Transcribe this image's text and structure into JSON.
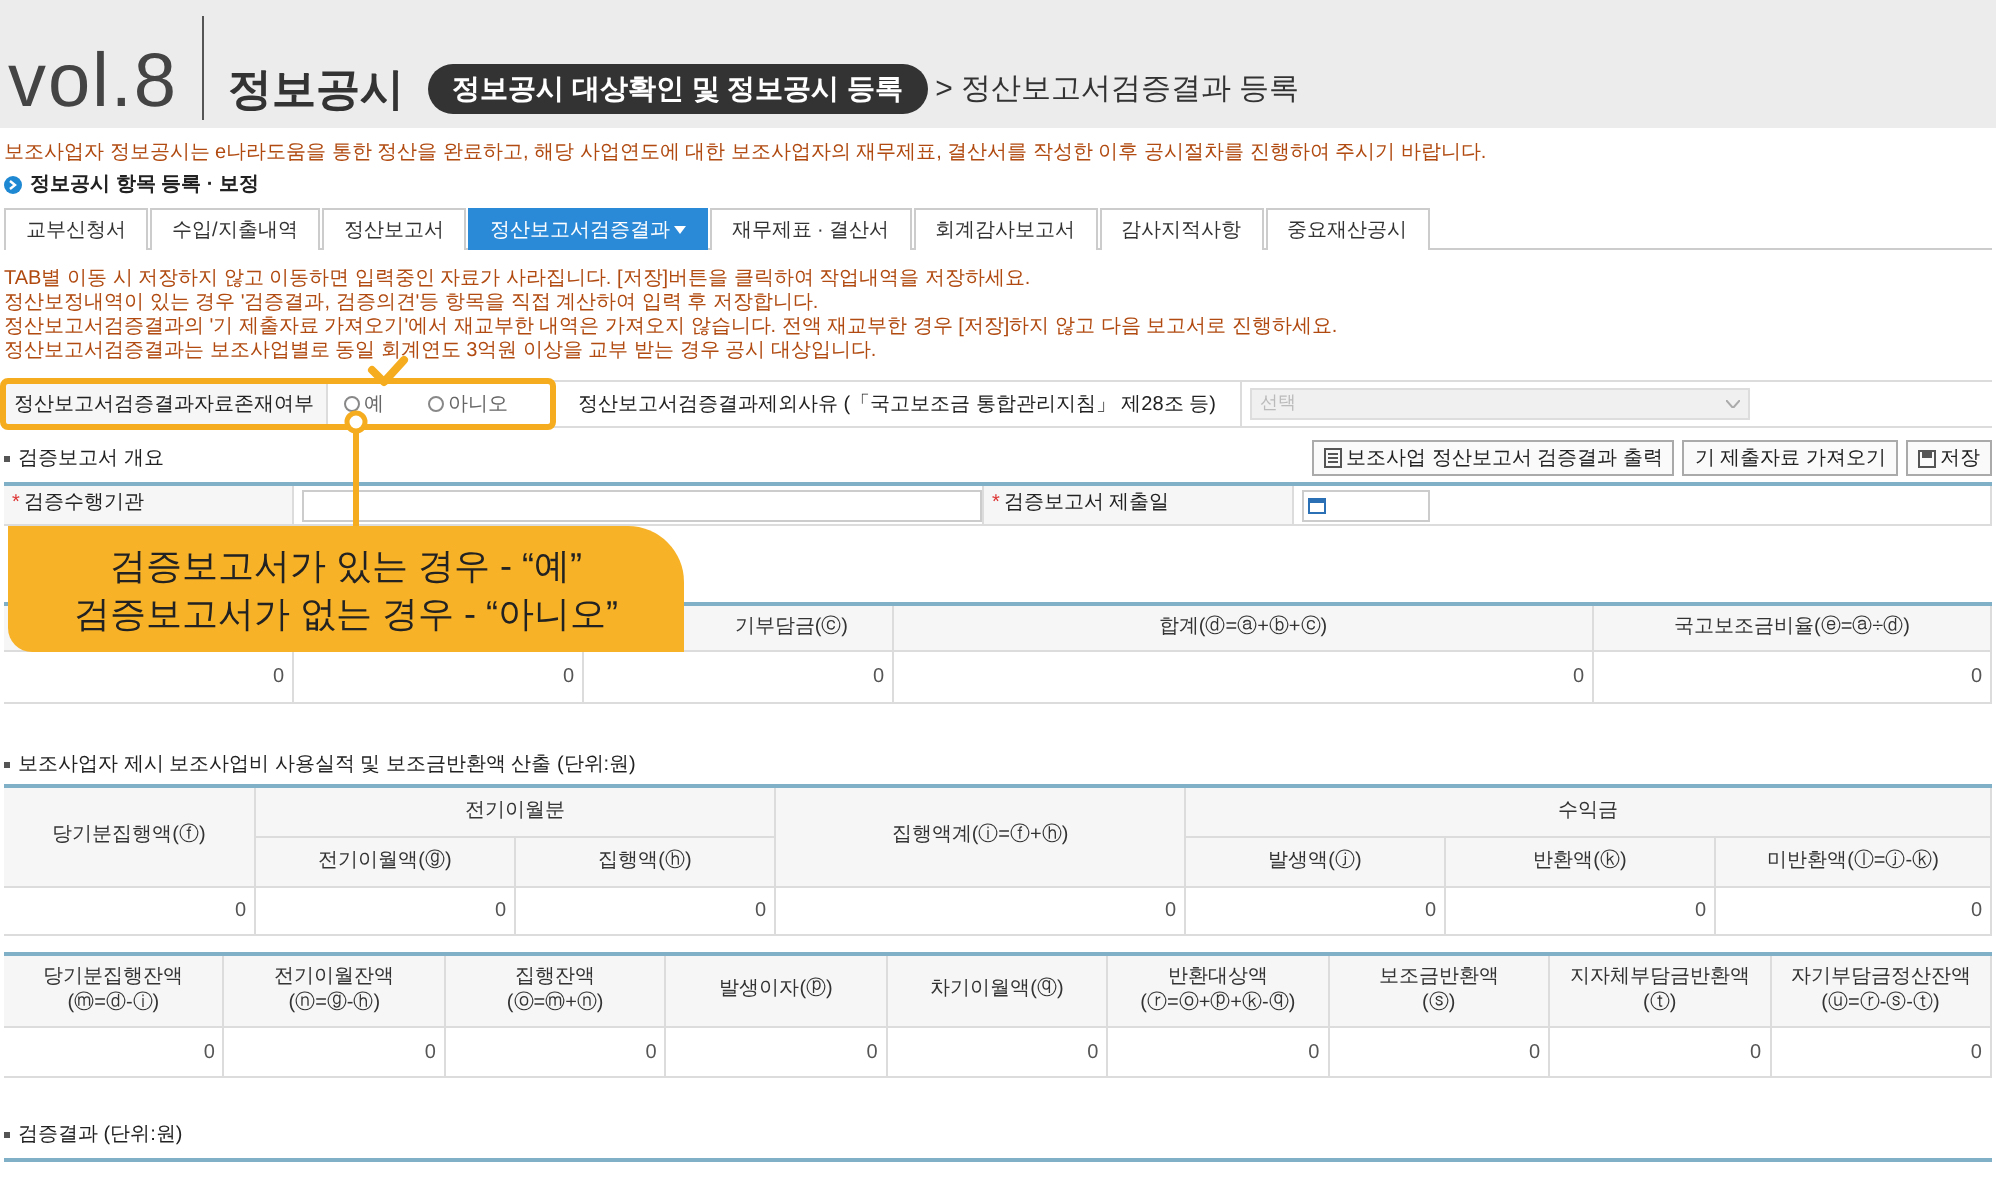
{
  "header": {
    "vol": "vol.8",
    "title": "정보공시",
    "pill": "정보공시 대상확인 및 정보공시 등록",
    "breadcrumb": "> 정산보고서검증결과 등록"
  },
  "notice": "보조사업자 정보공시는 e나라도움을 통한 정산을 완료하고, 해당 사업연도에 대한 보조사업자의 재무제표, 결산서를 작성한 이후 공시절차를 진행하여 주시기 바랍니다.",
  "section_title": "정보공시 항목 등록 · 보정",
  "tabs": [
    {
      "label": "교부신청서",
      "selected": false
    },
    {
      "label": "수입/지출내역",
      "selected": false
    },
    {
      "label": "정산보고서",
      "selected": false
    },
    {
      "label": "정산보고서검증결과",
      "selected": true
    },
    {
      "label": "재무제표 · 결산서",
      "selected": false
    },
    {
      "label": "회계감사보고서",
      "selected": false
    },
    {
      "label": "감사지적사항",
      "selected": false
    },
    {
      "label": "중요재산공시",
      "selected": false
    }
  ],
  "notes": [
    "TAB별 이동 시 저장하지 않고 이동하면 입력중인 자료가 사라집니다. [저장]버튼을 클릭하여 작업내역을 저장하세요.",
    "정산보정내역이 있는 경우 '검증결과, 검증의견'등 항목을 직접 계산하여 입력 후 저장합니다.",
    "정산보고서검증결과의 '기 제출자료 가져오기'에서 재교부한 내역은 가져오지 않습니다. 전액 재교부한 경우 [저장]하지 않고 다음 보고서로 진행하세요.",
    "정산보고서검증결과는 보조사업별로 동일 회계연도 3억원 이상을 교부 받는 경우 공시 대상입니다."
  ],
  "existence": {
    "label": "정산보고서검증결과자료존재여부",
    "options": [
      {
        "label": "예",
        "selected": false
      },
      {
        "label": "아니오",
        "selected": false
      }
    ],
    "reason_label": "정산보고서검증결과제외사유 (「국고보조금 통합관리지침」 제28조 등)",
    "select": {
      "value": "선택",
      "disabled": true
    }
  },
  "overview": {
    "title": "검증보고서 개요",
    "required_symbol": "*",
    "buttons": [
      {
        "label": "보조사업 정산보고서 검증결과 출력",
        "kind": "print"
      },
      {
        "label": "기 제출자료 가져오기",
        "kind": "import"
      },
      {
        "label": "저장",
        "kind": "save"
      }
    ],
    "fields": [
      {
        "label": "검증수행기관",
        "required": true,
        "kind": "text"
      },
      {
        "label": "검증보고서 제출일",
        "required": true,
        "kind": "date"
      }
    ]
  },
  "summary_table": {
    "columns": [
      {
        "value": "0"
      },
      {
        "value": "0"
      },
      {
        "header": "기부담금(ⓒ)",
        "value": "0"
      },
      {
        "header": "합계(ⓓ=ⓐ+ⓑ+ⓒ)",
        "value": "0"
      },
      {
        "header": "국고보조금비율(ⓔ=ⓐ÷ⓓ)",
        "value": "0"
      }
    ]
  },
  "usage_section": {
    "title": "보조사업자 제시 보조사업비 사용실적 및 보조금반환액 산출 (단위:원)",
    "table_1": {
      "col_1": "당기분집행액(ⓕ)",
      "group_1": "전기이월분",
      "group_1_columns": [
        "전기이월액(ⓖ)",
        "집행액(ⓗ)"
      ],
      "col_4": "집행액계(ⓘ=ⓕ+ⓗ)",
      "group_2": "수익금",
      "group_2_columns": [
        "발생액(ⓙ)",
        "반환액(ⓚ)",
        "미반환액(ⓛ=ⓙ-ⓚ)"
      ],
      "values": [
        "0",
        "0",
        "0",
        "0",
        "0",
        "0",
        "0"
      ]
    },
    "table_2": {
      "columns": [
        {
          "name": "당기분집행잔액",
          "formula": "(ⓜ=ⓓ-ⓘ)"
        },
        {
          "name": "전기이월잔액",
          "formula": "(ⓝ=ⓖ-ⓗ)"
        },
        {
          "name": "집행잔액",
          "formula": "(ⓞ=ⓜ+ⓝ)"
        },
        {
          "name": "발생이자(ⓟ)"
        },
        {
          "name": "차기이월액(ⓠ)"
        },
        {
          "name": "반환대상액",
          "formula": "(ⓡ=ⓞ+ⓟ+ⓚ-ⓠ)"
        },
        {
          "name": "보조금반환액",
          "formula": "(ⓢ)"
        },
        {
          "name": "지자체부담금반환액",
          "formula": "(ⓣ)"
        },
        {
          "name": "자기부담금정산잔액",
          "formula": "(ⓤ=ⓡ-ⓢ-ⓣ)"
        }
      ],
      "values": [
        "0",
        "0",
        "0",
        "0",
        "0",
        "0",
        "0",
        "0",
        "0"
      ]
    }
  },
  "result_title": "검증결과 (단위:원)",
  "callout": {
    "lines": [
      "검증보고서가 있는 경우 - “예”",
      "검증보고서가 없는 경우 - “아니오”"
    ]
  }
}
